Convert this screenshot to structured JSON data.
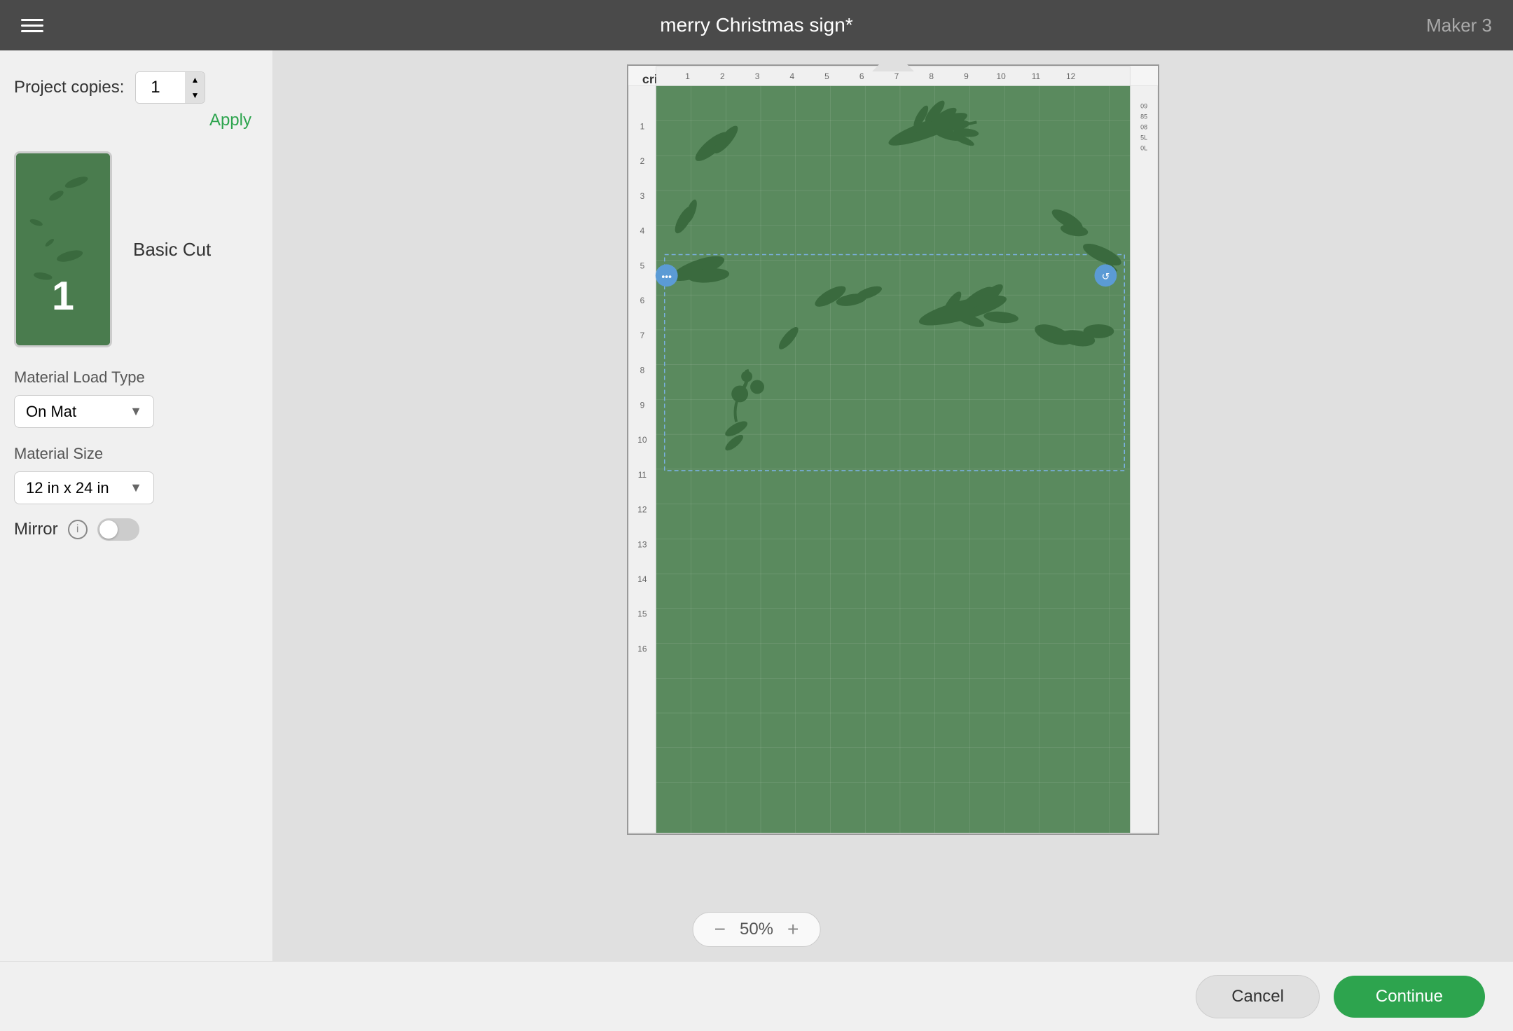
{
  "header": {
    "title": "merry Christmas sign*",
    "machine": "Maker 3",
    "menu_icon": "☰"
  },
  "left_panel": {
    "project_copies_label": "Project copies:",
    "project_copies_value": "1",
    "apply_label": "Apply",
    "mat_number": "1",
    "mat_cut_type": "Basic Cut",
    "material_load_type_label": "Material Load Type",
    "material_load_type_value": "On Mat",
    "material_size_label": "Material Size",
    "material_size_value": "12 in x 24 in",
    "mirror_label": "Mirror",
    "mirror_state": "off"
  },
  "zoom": {
    "level": "50%",
    "minus": "−",
    "plus": "+"
  },
  "footer": {
    "cancel_label": "Cancel",
    "continue_label": "Continue"
  }
}
